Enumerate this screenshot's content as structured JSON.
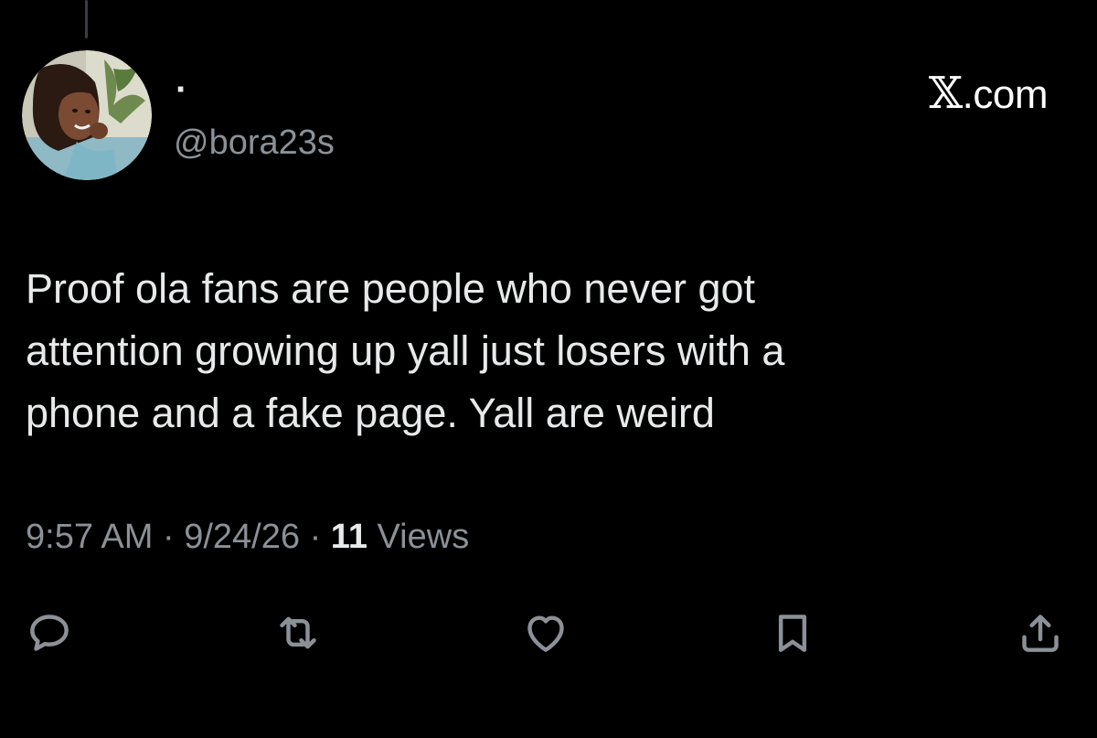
{
  "user": {
    "display_name": "·",
    "handle": "@bora23s"
  },
  "brand": {
    "x_glyph": "𝕏",
    "suffix": ".com"
  },
  "tweet": {
    "text": "Proof ola fans are people who never got\nattention growing up yall just losers with a\nphone and a fake page. Yall are weird",
    "time": "9:57 AM",
    "separator": "·",
    "date": "9/24/26",
    "views_count": "11",
    "views_label": "Views"
  },
  "actions": {
    "reply": "reply-icon",
    "repost": "repost-icon",
    "like": "heart-icon",
    "bookmark": "bookmark-icon",
    "share": "share-icon"
  },
  "colors": {
    "background": "#000000",
    "text_primary": "#e7e9ea",
    "text_secondary": "#8b9197",
    "icon": "#8b9197"
  }
}
